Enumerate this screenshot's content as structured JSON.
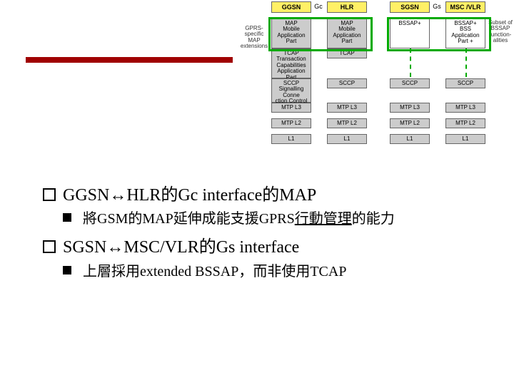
{
  "diagram": {
    "interfaces": [
      "Gc",
      "Gs"
    ],
    "left_note": "GPRS-\nspecific\nMAP\nextensions",
    "right_note": "Subset of\nBSSAP\nfunction-\nalities",
    "cols": [
      {
        "header": "GGSN",
        "rows": [
          "MAP\nMobile\nApplication\nPart",
          "TCAP\nTransaction\nCapabilities\nApplication Part",
          "SCCP\nSignalling Conne\nction Control Part",
          "MTP L3",
          "MTP L2",
          "L1"
        ]
      },
      {
        "header": "HLR",
        "rows": [
          "MAP\nMobile\nApplication\nPart",
          "TCAP",
          "SCCP",
          "MTP L3",
          "MTP L2",
          "L1"
        ]
      },
      {
        "header": "SGSN",
        "rows": [
          "BSSAP+",
          "",
          "SCCP",
          "MTP L3",
          "MTP L2",
          "L1"
        ]
      },
      {
        "header": "MSC /VLR",
        "rows": [
          "BSSAP+\nBSS\nApplication\nPart +",
          "",
          "SCCP",
          "MTP L3",
          "MTP L2",
          "L1"
        ]
      }
    ]
  },
  "bullets": {
    "b1": "GGSN↔HLR的Gc interface的MAP",
    "b1a_pre": "將GSM的MAP延伸成能支援GPRS",
    "b1a_ul": "行動管理",
    "b1a_post": "的能力",
    "b2": "SGSN↔MSC/VLR的Gs interface",
    "b2a": "上層採用extended BSSAP，而非使用TCAP"
  }
}
